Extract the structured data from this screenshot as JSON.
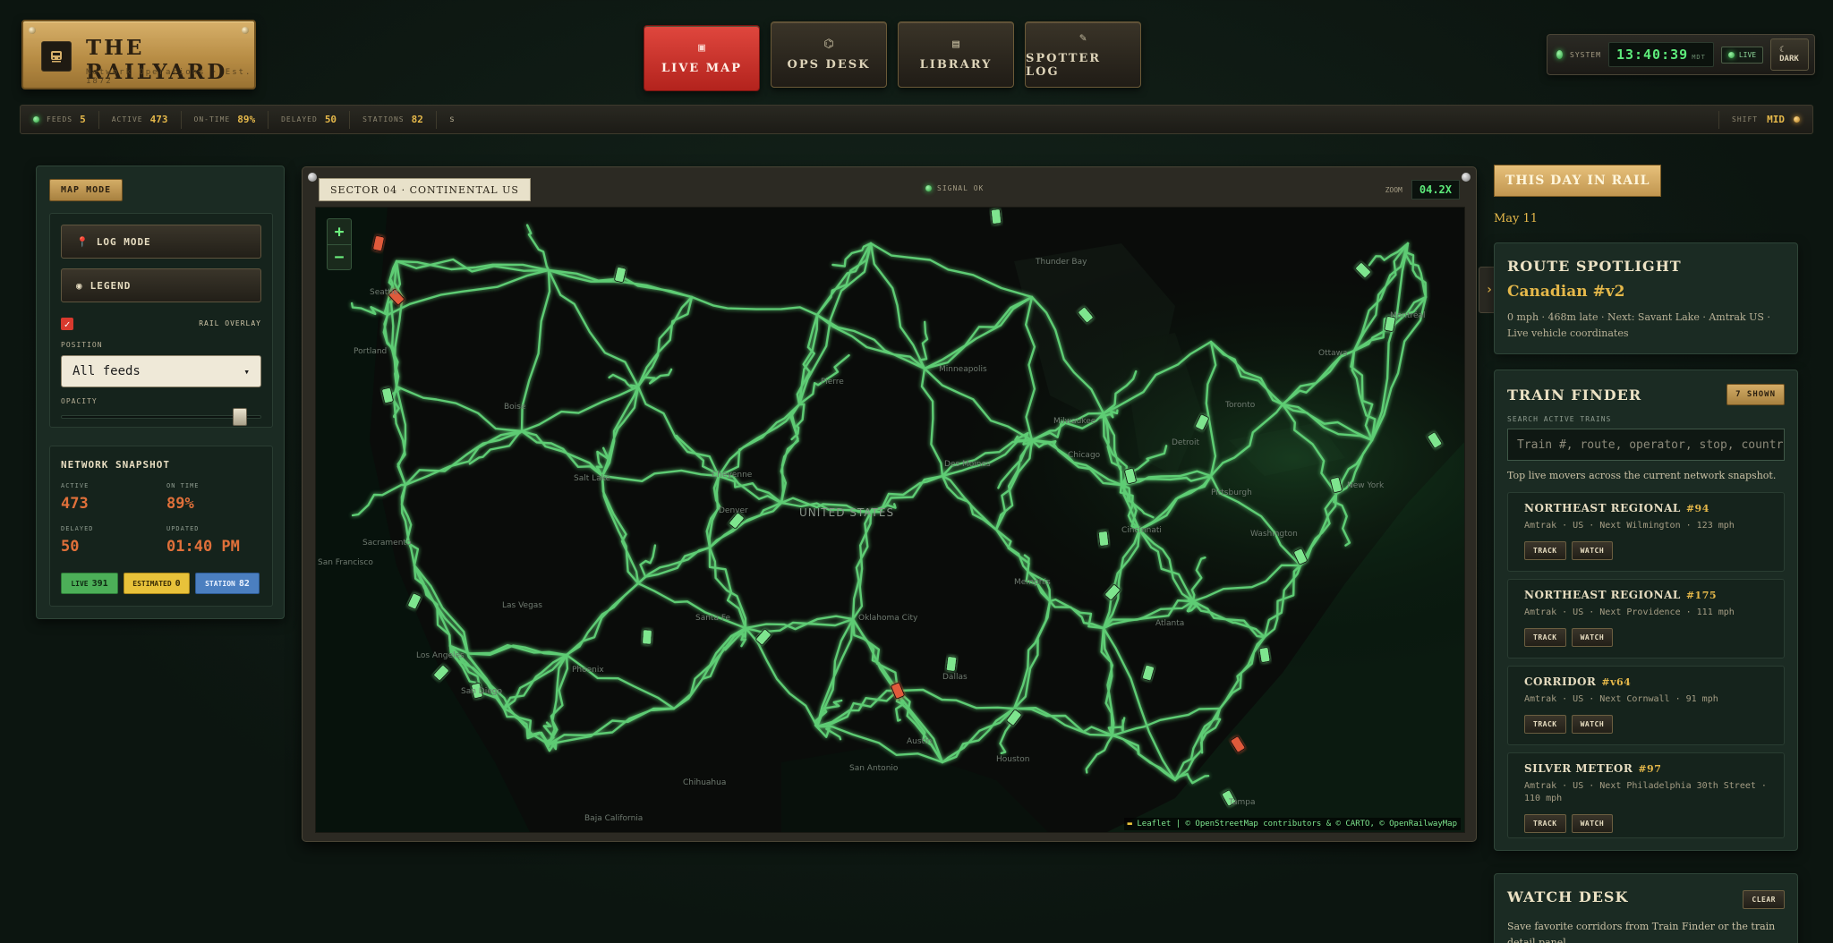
{
  "brand": {
    "title": "THE RAILYARD",
    "subtitle": "Network Operations · Est. 1872",
    "logo_icon": "train-icon"
  },
  "nav": [
    {
      "label": "LIVE MAP",
      "icon": "map-icon",
      "active": true
    },
    {
      "label": "OPS DESK",
      "icon": "signal-icon",
      "active": false
    },
    {
      "label": "LIBRARY",
      "icon": "book-icon",
      "active": false
    },
    {
      "label": "SPOTTER LOG",
      "icon": "pencil-icon",
      "active": false
    }
  ],
  "system": {
    "label": "SYSTEM",
    "time": "13:40:39",
    "tz": "MDT",
    "live_label": "LIVE",
    "dark_label": "DARK"
  },
  "status": {
    "feeds_label": "FEEDS",
    "feeds": "5",
    "active_label": "ACTIVE",
    "active": "473",
    "ontime_label": "ON-TIME",
    "ontime": "89%",
    "delayed_label": "DELAYED",
    "delayed": "50",
    "stations_label": "STATIONS",
    "stations": "82",
    "tail": "s",
    "shift_label": "SHIFT",
    "shift": "MID"
  },
  "left": {
    "mode_label": "MAP MODE",
    "log_mode": "LOG MODE",
    "legend": "LEGEND",
    "rail_overlay": "RAIL OVERLAY",
    "rail_overlay_checked": true,
    "position_label": "POSITION",
    "position_value": "All feeds",
    "opacity_label": "OPACITY",
    "opacity": 0.92,
    "snapshot": {
      "title": "NETWORK SNAPSHOT",
      "active_label": "ACTIVE",
      "active": "473",
      "ontime_label": "ON TIME",
      "ontime": "89%",
      "delayed_label": "DELAYED",
      "delayed": "50",
      "updated_label": "UPDATED",
      "updated": "01:40 PM",
      "chips": [
        {
          "label": "LIVE",
          "value": "391",
          "color": "#4caf58"
        },
        {
          "label": "ESTIMATED",
          "value": "0",
          "color": "#e8c23a"
        },
        {
          "label": "STATION",
          "value": "82",
          "color": "#4b7fc0"
        }
      ]
    }
  },
  "map": {
    "sector": "SECTOR 04 · CONTINENTAL US",
    "signal": "SIGNAL OK",
    "zoom_label": "ZOOM",
    "zoom_value": "04.2X",
    "zoom_in": "+",
    "zoom_out": "−",
    "attribution": "Leaflet | © OpenStreetMap contributors & © CARTO, © OpenRailwayMap",
    "country_label": "UNITED STATES",
    "places": [
      "Seattle",
      "Portland",
      "Boise",
      "Salt Lake",
      "Cheyenne",
      "Denver",
      "San Francisco",
      "Sacramento",
      "Las Vegas",
      "Los Angeles",
      "San Diego",
      "Phoenix",
      "Santa Fe",
      "Oklahoma City",
      "Dallas",
      "Austin",
      "Houston",
      "San Antonio",
      "Chihuahua",
      "Pierre",
      "Minneapolis",
      "Des Moines",
      "Chicago",
      "Milwaukee",
      "Thunder Bay",
      "Detroit",
      "Toronto",
      "Ottawa",
      "Montréal",
      "Cincinnati",
      "Pittsburgh",
      "Washington",
      "New York",
      "Atlanta",
      "Tampa",
      "Memphis",
      "Baja California"
    ]
  },
  "right": {
    "this_day_label": "THIS DAY IN RAIL",
    "this_day_date": "May 11",
    "spotlight": {
      "title": "ROUTE SPOTLIGHT",
      "route": "Canadian #v2",
      "meta": "0 mph · 468m late · Next: Savant Lake · Amtrak US · Live vehicle coordinates"
    },
    "finder": {
      "title": "TRAIN FINDER",
      "shown_label": "7 SHOWN",
      "search_label": "SEARCH ACTIVE TRAINS",
      "search_placeholder": "Train #, route, operator, stop, country",
      "caption": "Top live movers across the current network snapshot.",
      "track_label": "TRACK",
      "watch_label": "WATCH",
      "trains": [
        {
          "name": "NORTHEAST REGIONAL",
          "num": "#94",
          "meta": "Amtrak · US · Next Wilmington · 123 mph"
        },
        {
          "name": "NORTHEAST REGIONAL",
          "num": "#175",
          "meta": "Amtrak · US · Next Providence · 111 mph"
        },
        {
          "name": "CORRIDOR",
          "num": "#v64",
          "meta": "Amtrak · US · Next Cornwall · 91 mph"
        },
        {
          "name": "SILVER METEOR",
          "num": "#97",
          "meta": "Amtrak · US · Next Philadelphia 30th Street · 110 mph"
        }
      ]
    },
    "watch": {
      "title": "WATCH DESK",
      "clear_label": "CLEAR",
      "caption": "Save favorite corridors from Train Finder or the train detail panel."
    }
  }
}
